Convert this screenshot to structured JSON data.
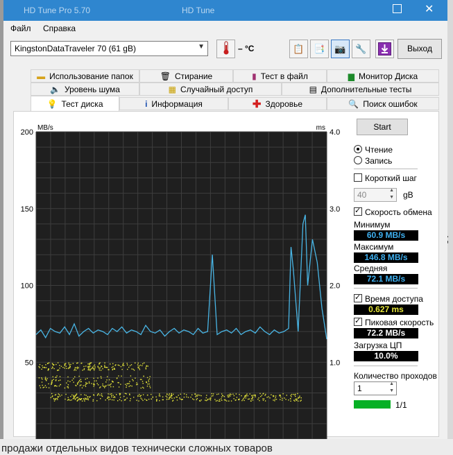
{
  "window": {
    "title_left": "HD Tune Pro 5.70",
    "title_right": "HD Tune"
  },
  "menu": {
    "file": "Файл",
    "help": "Справка"
  },
  "toolbar": {
    "drive": "KingstonDataTraveler 70 (61 gB)",
    "temperature": "– °C",
    "exit_label": "Выход"
  },
  "tabs": {
    "row1": [
      "Использование папок",
      "Стирание",
      "Тест в файл",
      "Монитор Диска"
    ],
    "row2": [
      "Уровень шума",
      "Случайный доступ",
      "Дополнительные  тесты"
    ],
    "row3": [
      "Тест диска",
      "Информация",
      "Здоровье",
      "Поиск ошибок"
    ],
    "active": "Тест диска"
  },
  "controls": {
    "start_label": "Start",
    "read_label": "Чтение",
    "write_label": "Запись",
    "mode": "read",
    "short_step_label": "Короткий шаг",
    "short_step_checked": false,
    "step_value": "40",
    "step_unit": "gB",
    "transfer_rate_label": "Скорость обмена",
    "transfer_rate_checked": true,
    "min_label": "Минимум",
    "min_value": "60.9 MB/s",
    "max_label": "Максимум",
    "max_value": "146.8 MB/s",
    "avg_label": "Средняя",
    "avg_value": "72.1 MB/s",
    "access_time_label": "Время доступа",
    "access_time_checked": true,
    "access_time_value": "0.627 ms",
    "burst_label": "Пиковая скорость",
    "burst_checked": true,
    "burst_value": "72.2 MB/s",
    "cpu_label": "Загрузка ЦП",
    "cpu_value": "10.0%",
    "passes_label": "Количество проходов",
    "passes_value": "1",
    "progress_text": "1/1",
    "progress_fraction": 1.0
  },
  "background": {
    "bottom_text": "продажи отдельных видов технически сложных товаров"
  },
  "colors": {
    "accent": "#2f86cf",
    "chart_bg": "#1f1f1f",
    "grid": "#3e3e3e",
    "transfer_line": "#49b6e6",
    "access_dots": "#e4e43a",
    "progress": "#06b025"
  },
  "chart_data": {
    "type": "line",
    "y_left_unit": "MB/s",
    "y_right_unit": "ms",
    "y_left_ticks": [
      "200",
      "150",
      "100",
      "50"
    ],
    "y_right_ticks": [
      "4.00",
      "3.00",
      "2.00",
      "1.00"
    ],
    "y_left_range": [
      0,
      200
    ],
    "y_right_range": [
      0,
      4
    ],
    "x_range": [
      0,
      61
    ],
    "grid": true,
    "series": [
      {
        "kind": "transfer-rate",
        "x": [
          0,
          1,
          2,
          3,
          4,
          5,
          6,
          7,
          8,
          9,
          10,
          11,
          12,
          13,
          14,
          15,
          16,
          17,
          18,
          19,
          20,
          21,
          22,
          23,
          24,
          25,
          26,
          27,
          28,
          29,
          30,
          31,
          32,
          33,
          34,
          35,
          36,
          37,
          38,
          39,
          40,
          41,
          42,
          43,
          44,
          45,
          46,
          47,
          48,
          49,
          50,
          51,
          52,
          53,
          53.5,
          54,
          55,
          56,
          56.5,
          57,
          58,
          59,
          60,
          61
        ],
        "values": [
          68,
          71,
          66,
          72,
          70,
          69,
          73,
          68,
          75,
          67,
          70,
          72,
          69,
          71,
          70,
          68,
          72,
          70,
          73,
          69,
          71,
          70,
          68,
          74,
          70,
          69,
          71,
          67,
          70,
          72,
          69,
          71,
          70,
          68,
          72,
          69,
          70,
          120,
          68,
          70,
          71,
          69,
          72,
          68,
          70,
          71,
          69,
          73,
          70,
          68,
          71,
          69,
          70,
          72,
          125,
          110,
          70,
          140,
          146,
          100,
          130,
          115,
          85,
          65
        ]
      },
      {
        "kind": "access-time",
        "clusters": [
          {
            "x_range": [
              0.5,
              24
            ],
            "y_center": 0.95,
            "y_spread": 0.05
          },
          {
            "x_range": [
              3,
              56
            ],
            "y_center": 0.55,
            "y_spread": 0.05
          },
          {
            "x_range": [
              0.5,
              24
            ],
            "y_center": 0.75,
            "y_spread": 0.08
          }
        ]
      }
    ]
  }
}
